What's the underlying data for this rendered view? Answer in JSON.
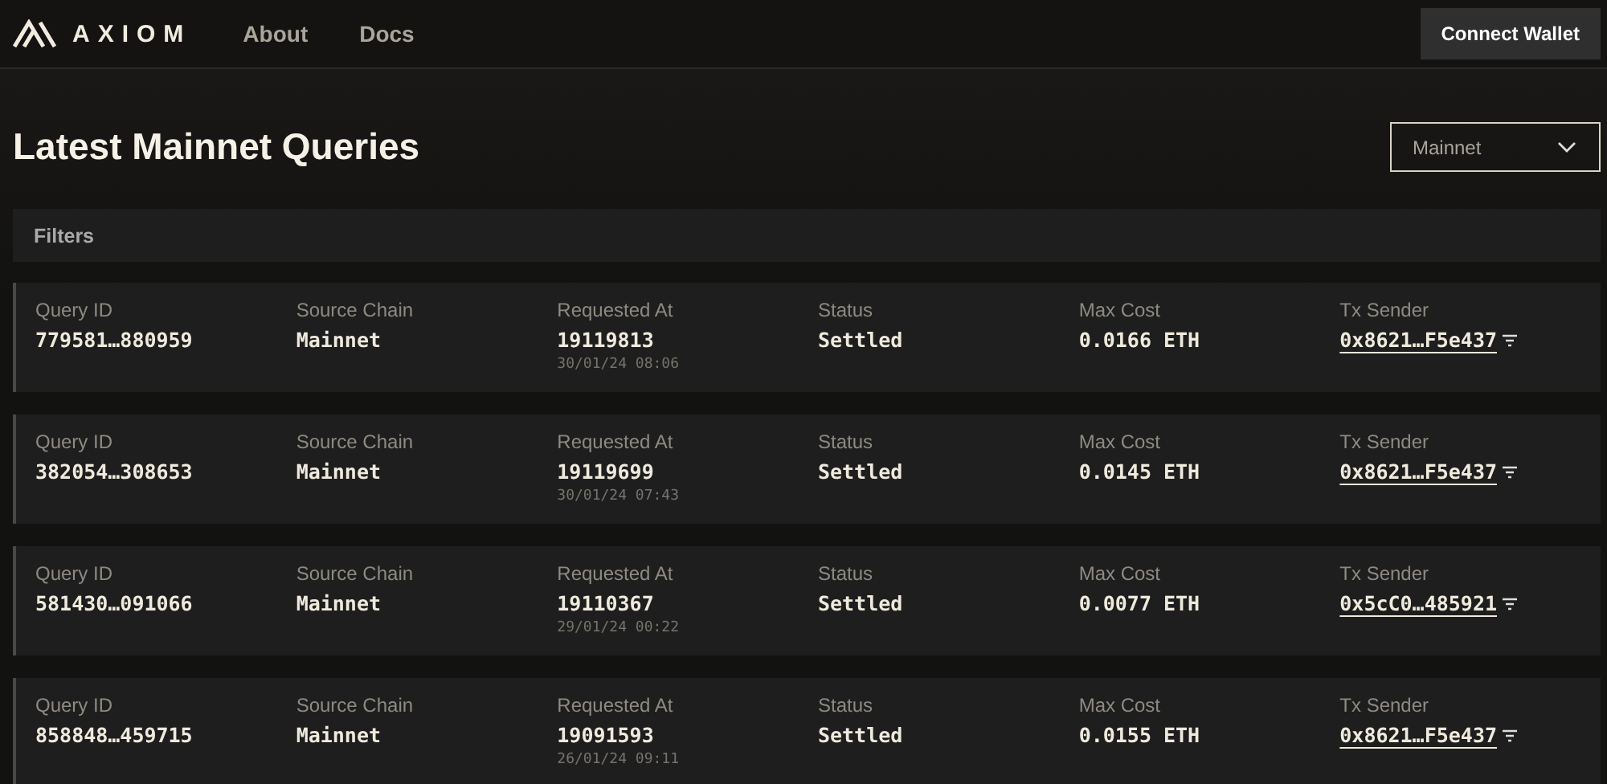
{
  "nav": {
    "brand": "AXIOM",
    "links": [
      "About",
      "Docs"
    ],
    "action": "Connect Wallet"
  },
  "title": "Latest Mainnet Queries",
  "network_select": {
    "value": "Mainnet"
  },
  "filters": {
    "label": "Filters"
  },
  "queries": [
    {
      "labels": [
        "Query ID",
        "Source Chain",
        "Requested At",
        "Status",
        "Max Cost",
        "Tx Sender"
      ],
      "query_id": "779581…880959",
      "source_chain": "Mainnet",
      "block": "19119813",
      "time": "30/01/24 08:06",
      "status": "Settled",
      "max_cost": "0.0166 ETH",
      "tx_sender": "0x8621…F5e437"
    },
    {
      "labels": [
        "Query ID",
        "Source Chain",
        "Requested At",
        "Status",
        "Max Cost",
        "Tx Sender"
      ],
      "query_id": "382054…308653",
      "source_chain": "Mainnet",
      "block": "19119699",
      "time": "30/01/24 07:43",
      "status": "Settled",
      "max_cost": "0.0145 ETH",
      "tx_sender": "0x8621…F5e437"
    },
    {
      "labels": [
        "Query ID",
        "Source Chain",
        "Requested At",
        "Status",
        "Max Cost",
        "Tx Sender"
      ],
      "query_id": "581430…091066",
      "source_chain": "Mainnet",
      "block": "19110367",
      "time": "29/01/24 00:22",
      "status": "Settled",
      "max_cost": "0.0077 ETH",
      "tx_sender": "0x5cC0…485921"
    },
    {
      "labels": [
        "Query ID",
        "Source Chain",
        "Requested At",
        "Status",
        "Max Cost",
        "Tx Sender"
      ],
      "query_id": "858848…459715",
      "source_chain": "Mainnet",
      "block": "19091593",
      "time": "26/01/24 09:11",
      "status": "Settled",
      "max_cost": "0.0155 ETH",
      "tx_sender": "0x8621…F5e437"
    }
  ]
}
